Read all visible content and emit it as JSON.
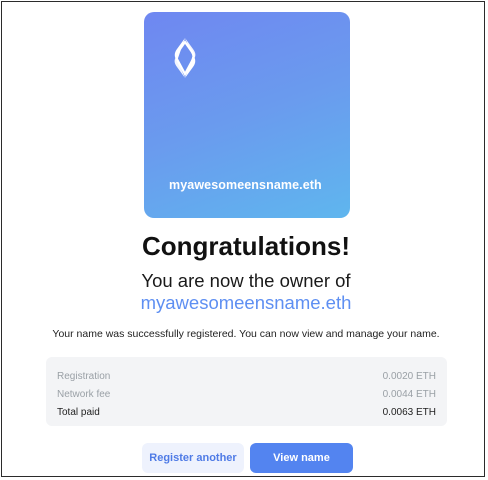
{
  "nft_card": {
    "name": "myawesomeensname.eth",
    "logo": "ens-logo-icon",
    "gradient_colors": [
      "#6f87f1",
      "#5fb6ee"
    ]
  },
  "title": "Congratulations!",
  "subtitle": "You are now the owner of",
  "subtitle_name": "myawesomeensname.eth",
  "message": "Your name was successfully registered. You can now view and manage your name.",
  "fees": [
    {
      "label": "Registration",
      "value": "0.0020 ETH"
    },
    {
      "label": "Network fee",
      "value": "0.0044 ETH"
    }
  ],
  "total": {
    "label": "Total paid",
    "value": "0.0063 ETH"
  },
  "buttons": {
    "register_another": "Register another",
    "view_name": "View name"
  },
  "colors": {
    "accent": "#5384f0",
    "name_highlight": "#5e8ff2",
    "secondary_button_bg": "#eef2fd"
  }
}
